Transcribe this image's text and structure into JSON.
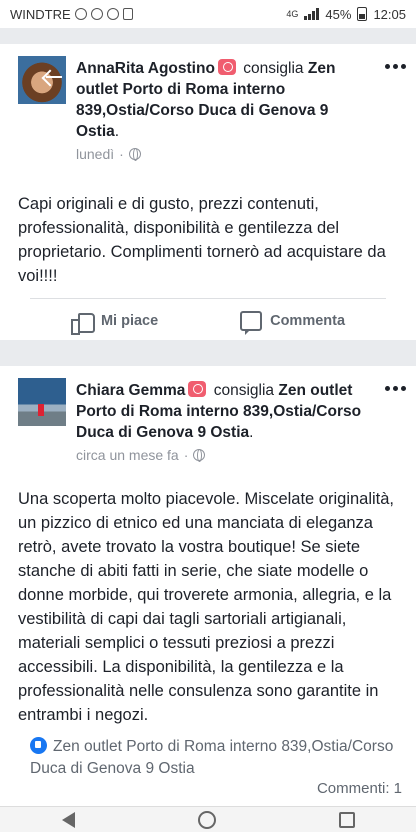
{
  "status_bar": {
    "carrier": "WINDTRE",
    "network": "4G",
    "battery": "45%",
    "time": "12:05"
  },
  "posts": [
    {
      "author": "AnnaRita Agostino",
      "action": "consiglia",
      "page": "Zen outlet Porto di Roma interno 839,Ostia/Corso Duca di Genova 9 Ostia",
      "period": ".",
      "time": "lunedì",
      "dot": "·",
      "text": "Capi originali e di gusto, prezzi contenuti, professionalità, disponibilità e gentilezza del proprietario. Complimenti tornerò ad acquistare da voi!!!!",
      "like_label": "Mi piace",
      "comment_label": "Commenta"
    },
    {
      "author": "Chiara Gemma",
      "action": "consiglia",
      "page": "Zen outlet Porto di Roma interno 839,Ostia/Corso Duca di Genova 9 Ostia",
      "period": ".",
      "time": "circa un mese fa",
      "dot": "·",
      "text": "Una scoperta molto piacevole. Miscelate originalità, un pizzico di etnico ed una manciata di eleganza retrò, avete trovato la vostra boutique! Se siete stanche di abiti fatti in serie, che siate modelle o donne morbide, qui troverete armonia, allegria, e la vestibilità di capi dai tagli sartoriali artigianali, materiali semplici o tessuti preziosi a prezzi accessibili. La disponibilità, la gentilezza e la professionalità nelle consulenza sono garantite in entrambi i negozi.",
      "page_ref": "Zen outlet Porto di Roma interno 839,Ostia/Corso Duca di Genova 9 Ostia",
      "comments_count": "Commenti: 1"
    }
  ]
}
